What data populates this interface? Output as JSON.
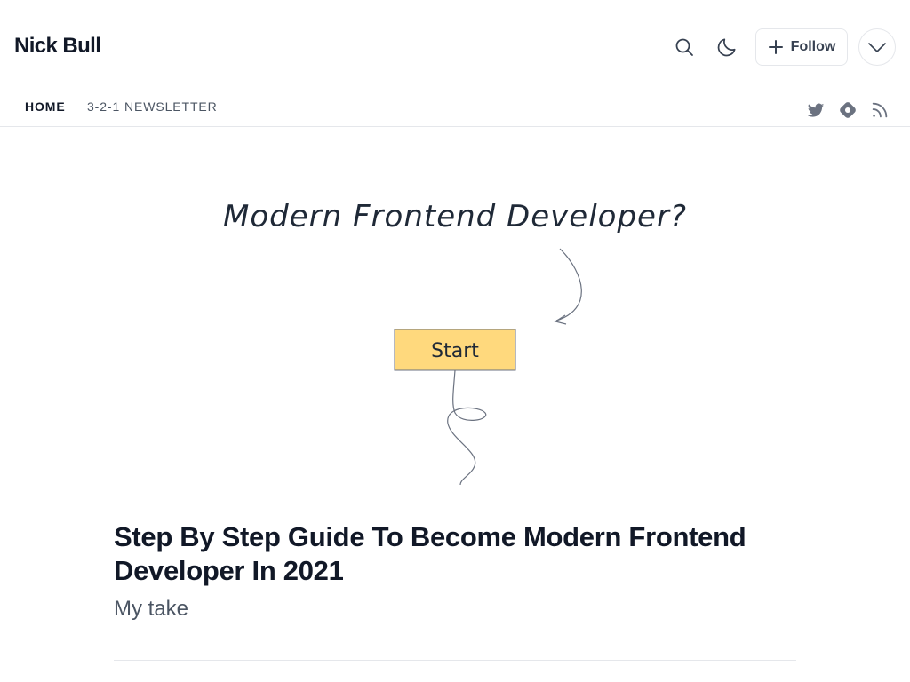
{
  "header": {
    "blog_title": "Nick Bull",
    "follow_label": "Follow",
    "icons": [
      "search-icon",
      "moon-icon",
      "plus-icon",
      "chevron-down-icon"
    ]
  },
  "nav": {
    "items": [
      {
        "label": "HOME",
        "active": true
      },
      {
        "label": "3-2-1 NEWSLETTER",
        "active": false
      }
    ],
    "social_icons": [
      "twitter-icon",
      "hashnode-icon",
      "rss-icon"
    ]
  },
  "cover": {
    "heading": "Modern Frontend Developer?",
    "box_label": "Start",
    "box_color": "#ffd97d"
  },
  "post": {
    "title": "Step By Step Guide To Become Modern Frontend Developer In 2021",
    "subtitle": "My take"
  },
  "colors": {
    "text": "#111827",
    "muted": "#4b5563",
    "border": "#e5e7eb",
    "icon": "#6b7280"
  }
}
